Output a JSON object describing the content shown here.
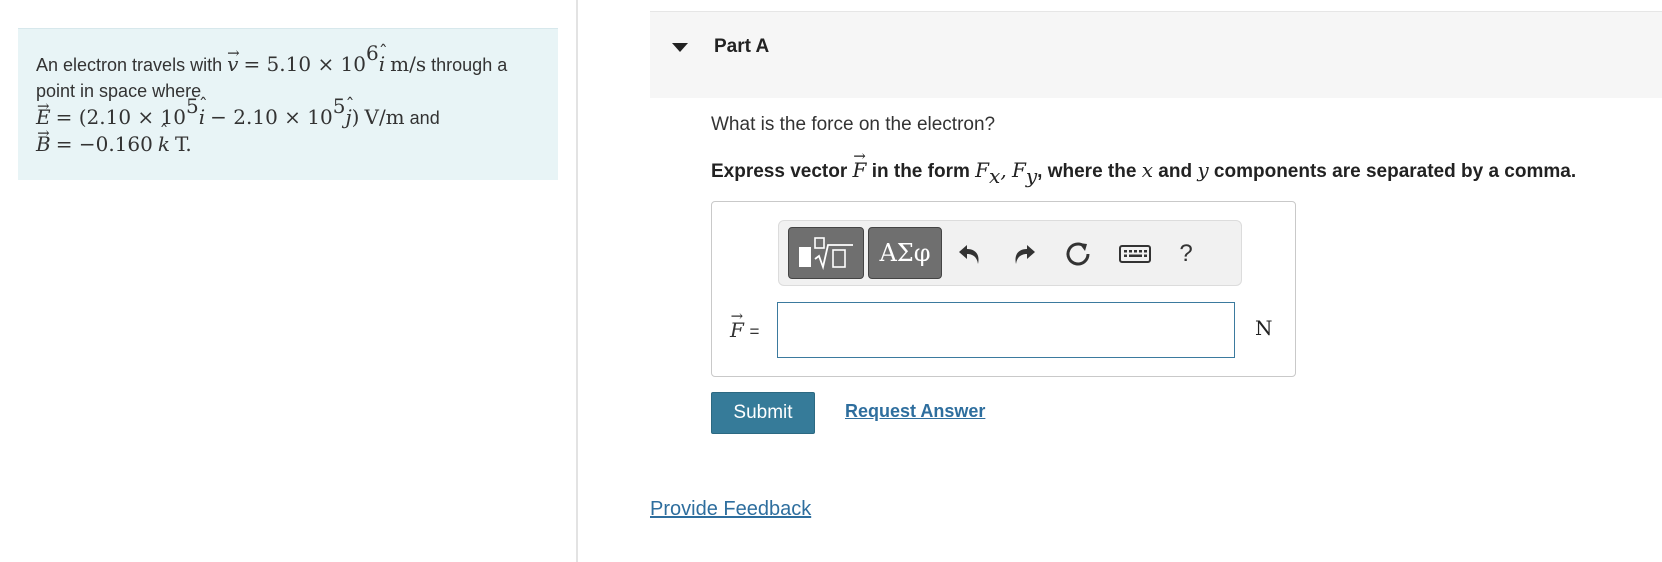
{
  "problem": {
    "text_prefix": "An electron travels with",
    "v_label": "v",
    "v_value": "= 5.10 × 10",
    "v_exp": "6",
    "v_unit_vec": "i",
    "v_unit": "m/s",
    "text_through": "through a",
    "text_point": "point in space where",
    "e_label": "E",
    "e_part1": "= (2.10 × 10",
    "e_exp1": "5",
    "e_vec1": "i",
    "e_part2": "− 2.10 × 10",
    "e_exp2": "5",
    "e_vec2": "j",
    "e_close": ")",
    "e_unit": "V/m",
    "text_and": "and",
    "b_label": "B",
    "b_value": "= −0.160",
    "b_vec": "k",
    "b_unit": "T."
  },
  "part": {
    "title": "Part A",
    "question": "What is the force on the electron?",
    "instruction_prefix": "Express vector",
    "instruction_vec": "F",
    "instruction_middle": "in the form",
    "fx": "F",
    "fx_sub": "x",
    "comma": ",",
    "fy": "F",
    "fy_sub": "y",
    "instruction_where": ", where the",
    "x_var": "x",
    "instruction_and": "and",
    "y_var": "y",
    "instruction_suffix": "components are separated by a comma."
  },
  "toolbar": {
    "symbols_label": "ΑΣφ",
    "help_label": "?",
    "icons": [
      "templates-icon",
      "undo-icon",
      "redo-icon",
      "reset-icon",
      "keyboard-icon",
      "help-icon"
    ]
  },
  "answer": {
    "lhs_vec": "F",
    "lhs_eq": "=",
    "value": "",
    "unit": "N"
  },
  "buttons": {
    "submit": "Submit",
    "request_answer": "Request Answer"
  },
  "footer": {
    "feedback": "Provide Feedback"
  },
  "colors": {
    "problem_bg": "#e8f4f6",
    "submit_bg": "#367b99",
    "link": "#2e6e9e",
    "toolbar_button": "#6f6f6f"
  }
}
